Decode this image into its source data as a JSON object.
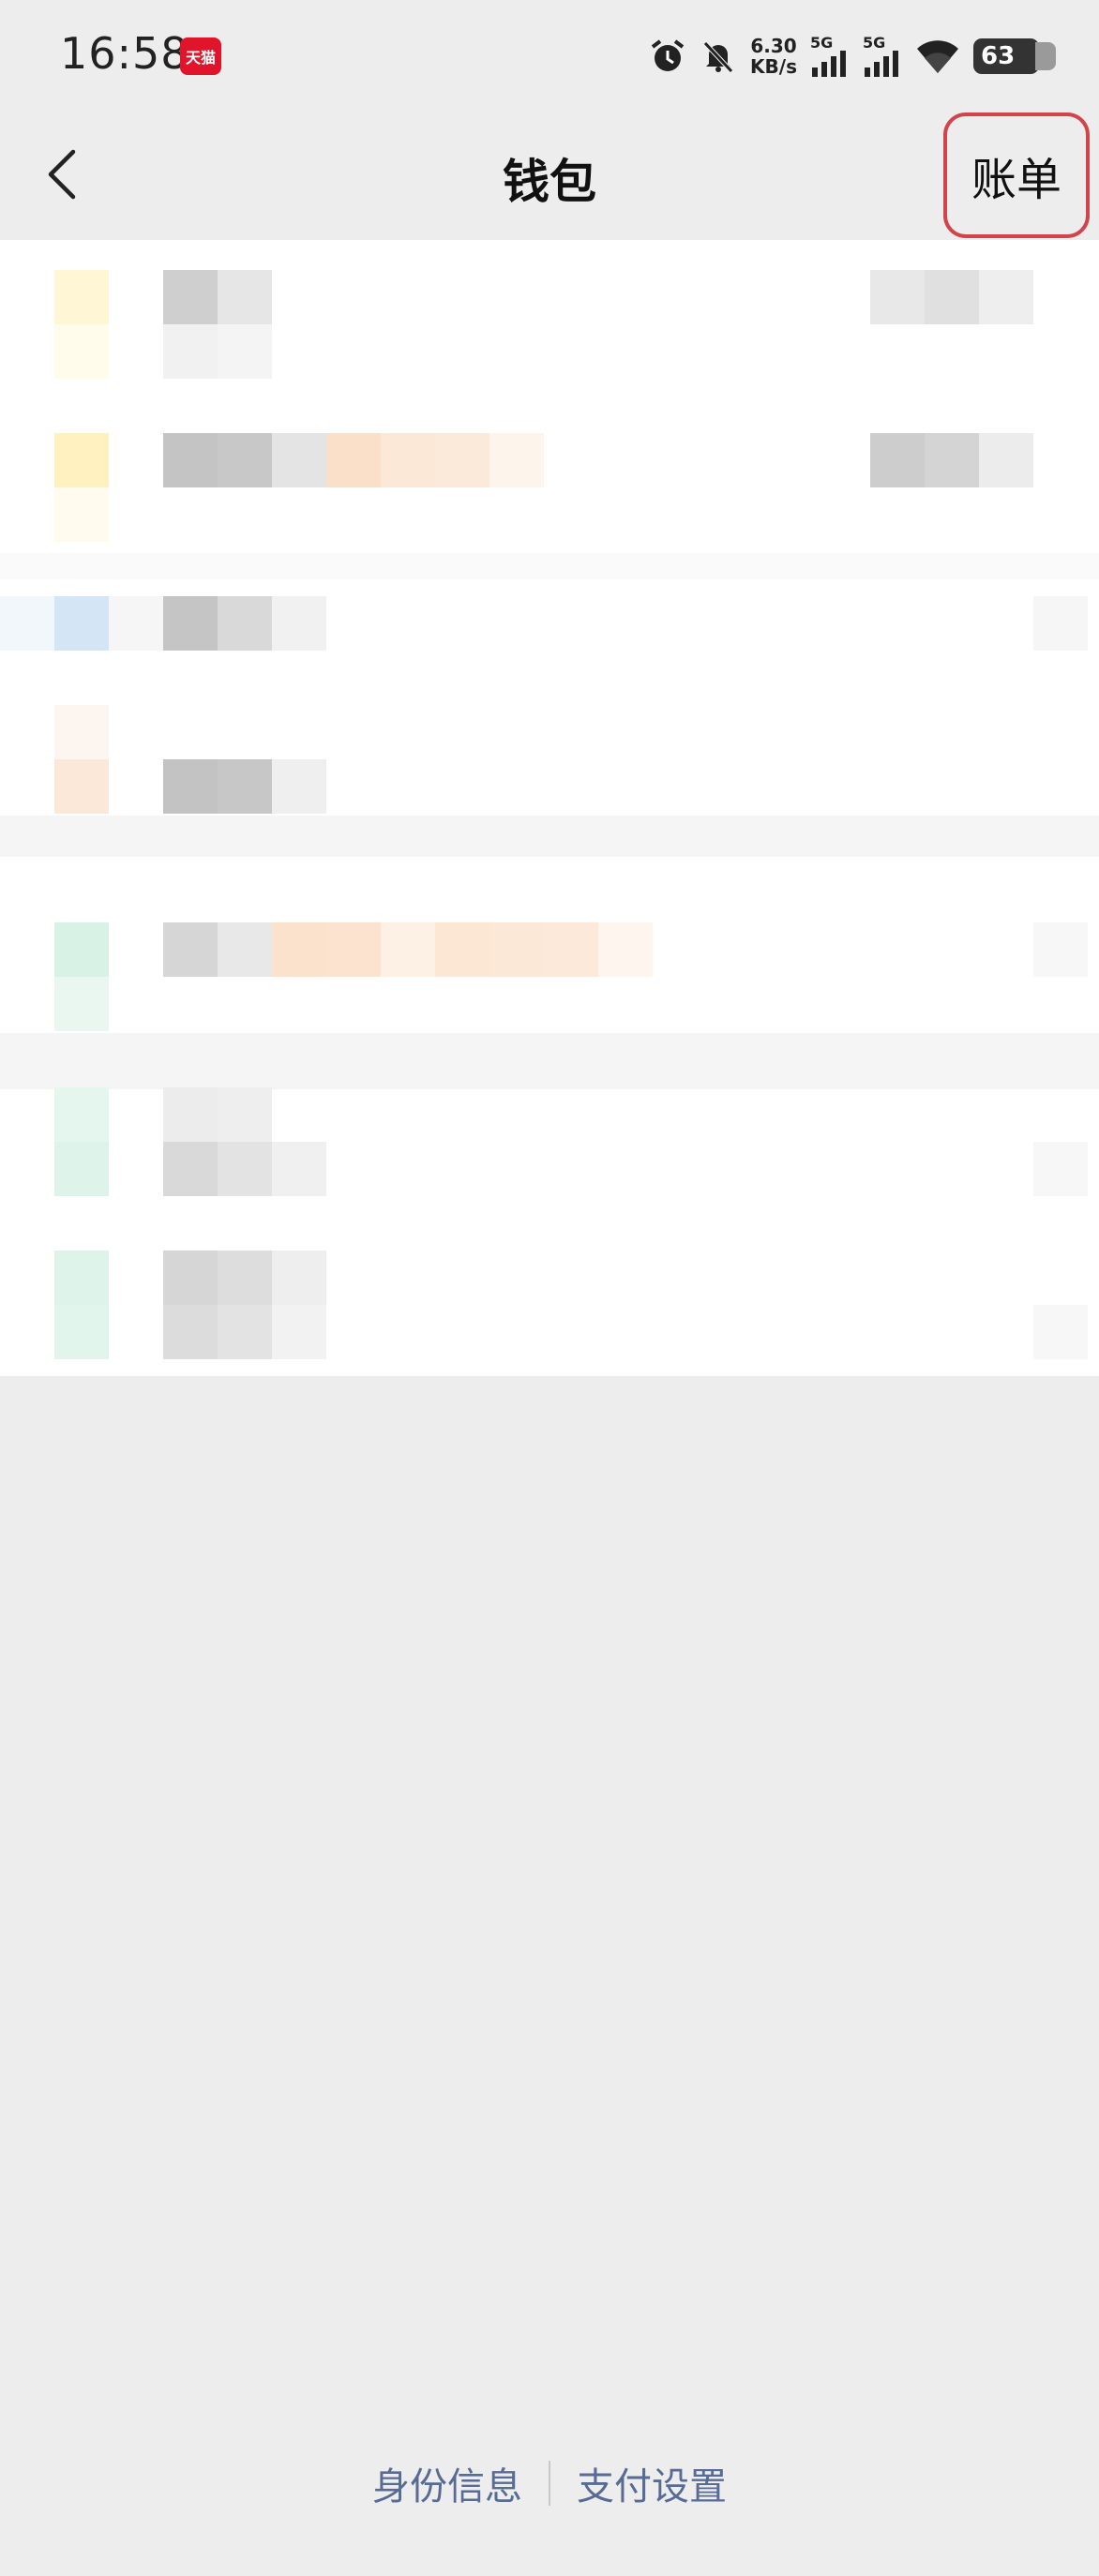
{
  "status_bar": {
    "time": "16:58",
    "app_badge": "天猫",
    "net_speed_value": "6.30",
    "net_speed_unit": "KB/s",
    "signal1_tag": "5G",
    "signal2_tag": "5G",
    "battery": "63"
  },
  "nav": {
    "title": "钱包",
    "bill_label": "账单"
  },
  "footer": {
    "identity_label": "身份信息",
    "payment_label": "支付设置"
  },
  "colors": {
    "background": "#ededed",
    "highlight_border": "#d2444c",
    "link": "#576b95"
  }
}
